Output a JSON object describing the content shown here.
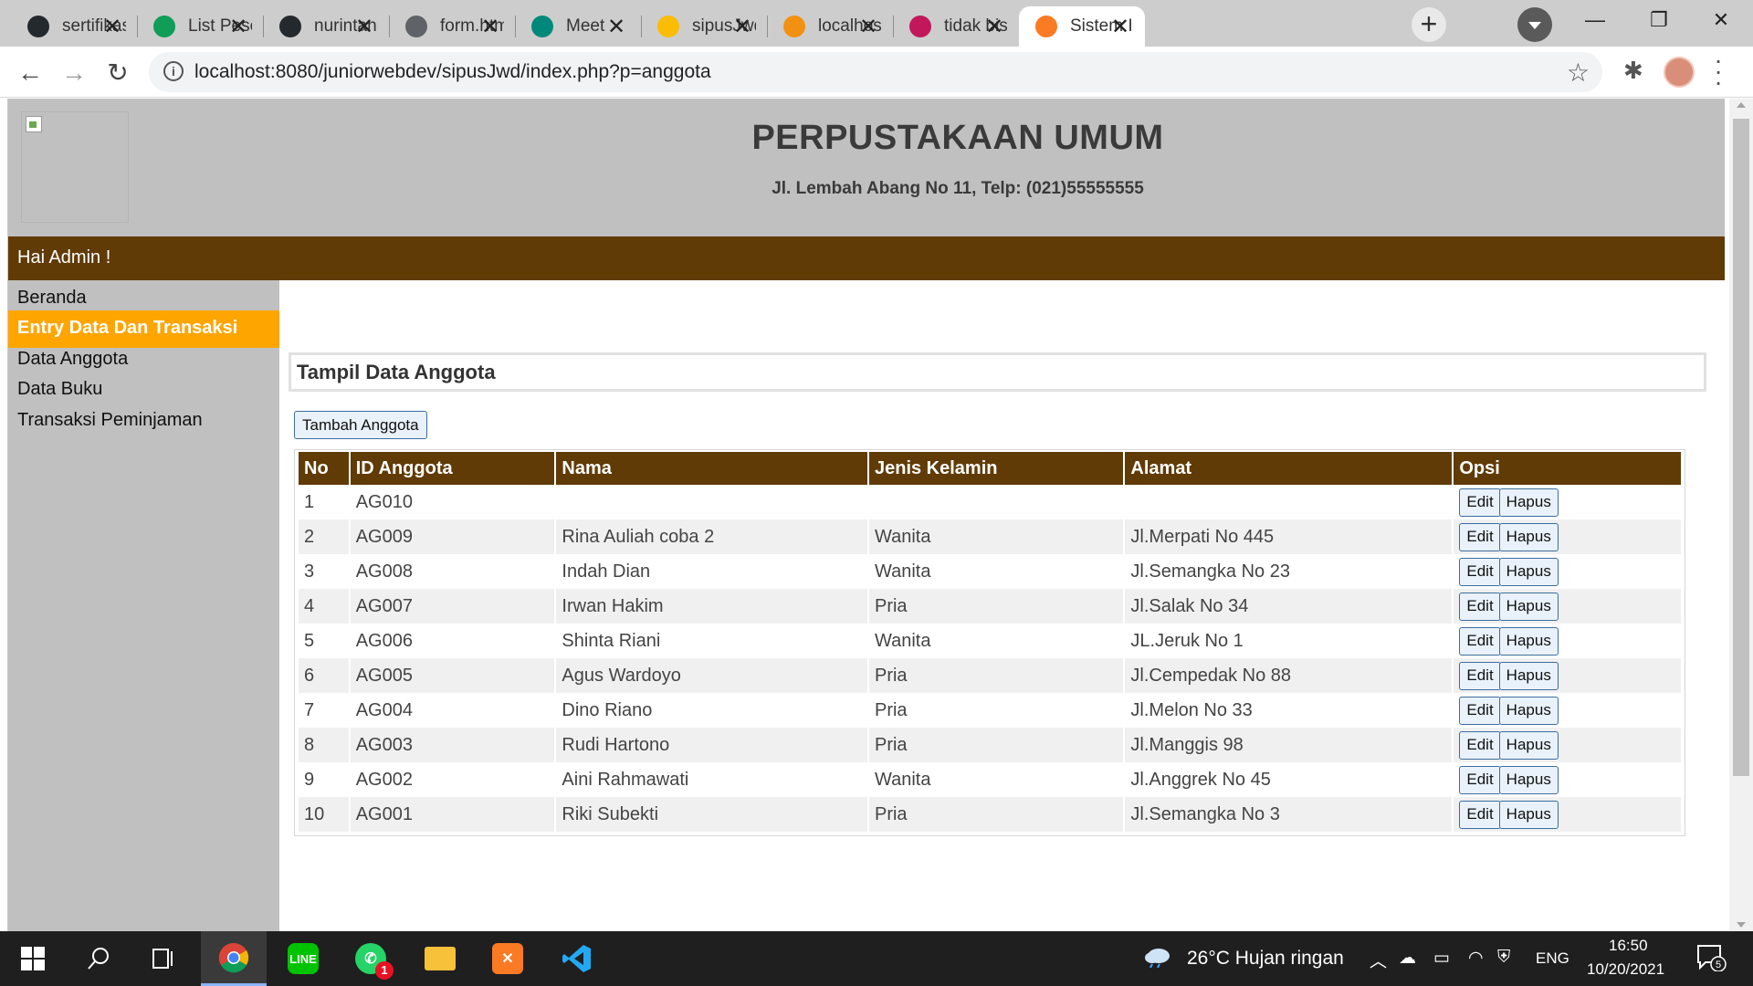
{
  "browser": {
    "tabs": [
      {
        "title": "sertifikasi",
        "icon": "github-icon",
        "color": "#24292e"
      },
      {
        "title": "List Peserta",
        "icon": "sheets-icon",
        "color": "#0f9d58"
      },
      {
        "title": "nurintanm",
        "icon": "github-icon",
        "color": "#24292e"
      },
      {
        "title": "form.html",
        "icon": "globe-icon",
        "color": "#5f6368"
      },
      {
        "title": "Meet",
        "icon": "meet-icon",
        "color": "#00897b"
      },
      {
        "title": "sipusJwd",
        "icon": "drive-icon",
        "color": "#fbbc04"
      },
      {
        "title": "localhost",
        "icon": "phpmyadmin-icon",
        "color": "#f29111"
      },
      {
        "title": "tidak bisa",
        "icon": "site-icon",
        "color": "#c2185b"
      },
      {
        "title": "Sistem Informasi",
        "icon": "xampp-icon",
        "color": "#fb7a24"
      }
    ],
    "new_tab_glyph": "+",
    "url": "localhost:8080/juniorwebdev/sipusJwd/index.php?p=anggota",
    "window_controls": {
      "minimize": "—",
      "restore": "❐",
      "close": "✕"
    }
  },
  "site": {
    "title": "PERPUSTAKAAN UMUM",
    "address": "Jl. Lembah Abang No 11, Telp: (021)55555555",
    "greeting": "Hai Admin !",
    "colors": {
      "header": "#c0c0c0",
      "brand": "#613b06",
      "active": "#ffa500"
    }
  },
  "sidebar": {
    "items": [
      {
        "label": "Beranda"
      },
      {
        "label": "Entry Data Dan Transaksi"
      },
      {
        "label": "Data Anggota"
      },
      {
        "label": "Data Buku"
      },
      {
        "label": "Transaksi Peminjaman"
      }
    ]
  },
  "main": {
    "heading": "Tampil Data Anggota",
    "add_button": "Tambah Anggota",
    "columns": [
      "No",
      "ID Anggota",
      "Nama",
      "Jenis Kelamin",
      "Alamat",
      "Opsi"
    ],
    "edit_label": "Edit",
    "delete_label": "Hapus",
    "rows": [
      {
        "no": "1",
        "id": "AG010",
        "nama": "",
        "jk": "",
        "alamat": ""
      },
      {
        "no": "2",
        "id": "AG009",
        "nama": "Rina Auliah coba 2",
        "jk": "Wanita",
        "alamat": "Jl.Merpati No 445"
      },
      {
        "no": "3",
        "id": "AG008",
        "nama": "Indah Dian",
        "jk": "Wanita",
        "alamat": "Jl.Semangka No 23"
      },
      {
        "no": "4",
        "id": "AG007",
        "nama": "Irwan Hakim",
        "jk": "Pria",
        "alamat": "Jl.Salak No 34"
      },
      {
        "no": "5",
        "id": "AG006",
        "nama": "Shinta Riani",
        "jk": "Wanita",
        "alamat": "JL.Jeruk No 1"
      },
      {
        "no": "6",
        "id": "AG005",
        "nama": "Agus Wardoyo",
        "jk": "Pria",
        "alamat": "Jl.Cempedak No 88"
      },
      {
        "no": "7",
        "id": "AG004",
        "nama": "Dino Riano",
        "jk": "Pria",
        "alamat": "Jl.Melon No 33"
      },
      {
        "no": "8",
        "id": "AG003",
        "nama": "Rudi Hartono",
        "jk": "Pria",
        "alamat": "Jl.Manggis 98"
      },
      {
        "no": "9",
        "id": "AG002",
        "nama": "Aini Rahmawati",
        "jk": "Wanita",
        "alamat": "Jl.Anggrek No 45"
      },
      {
        "no": "10",
        "id": "AG001",
        "nama": "Riki Subekti",
        "jk": "Pria",
        "alamat": "Jl.Semangka No 3"
      }
    ]
  },
  "taskbar": {
    "weather": "26°C  Hujan ringan",
    "lang": "ENG",
    "time": "16:50",
    "date": "10/20/2021",
    "notification_count": "5",
    "whatsapp_badge": "1"
  }
}
